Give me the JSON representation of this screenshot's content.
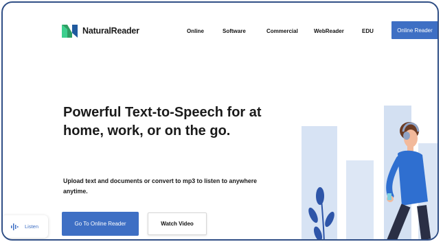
{
  "brand": {
    "name": "NaturalReader"
  },
  "nav": {
    "items": [
      "Online",
      "Software",
      "Commercial",
      "WebReader",
      "EDU"
    ],
    "cta_label": "Online Reader"
  },
  "hero": {
    "headline": "Powerful Text-to-Speech for at home, work, or on the go.",
    "subtext": "Upload text and documents or convert to mp3 to listen to anywhere anytime.",
    "primary_button": "Go To Online Reader",
    "secondary_button": "Watch Video"
  },
  "listen_widget": {
    "label": "Listen",
    "icon": "audio-wave-icon"
  },
  "colors": {
    "accent": "#3e6fc4",
    "frame": "#2f4e85",
    "text": "#1a1a1a"
  }
}
